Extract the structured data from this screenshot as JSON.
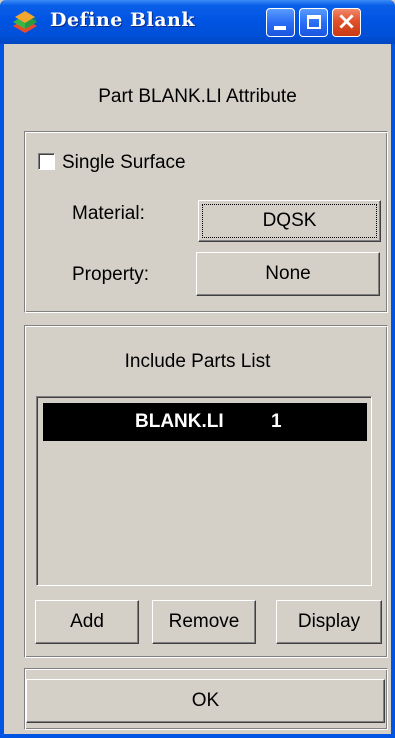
{
  "window": {
    "title": "Define Blank",
    "icon": "app-icon",
    "controls": {
      "minimize": "minimize-icon",
      "maximize": "maximize-icon",
      "close": "×"
    }
  },
  "header": {
    "label": "Part BLANK.LI Attribute"
  },
  "attributes": {
    "single_surface": {
      "label": "Single Surface",
      "checked": false
    },
    "material": {
      "label": "Material:",
      "value": "DQSK"
    },
    "property": {
      "label": "Property:",
      "value": "None"
    }
  },
  "parts": {
    "title": "Include Parts List",
    "items": [
      {
        "name": "BLANK.LI",
        "id": "1",
        "selected": true
      }
    ],
    "buttons": {
      "add": "Add",
      "remove": "Remove",
      "display": "Display"
    }
  },
  "footer": {
    "ok": "OK"
  }
}
